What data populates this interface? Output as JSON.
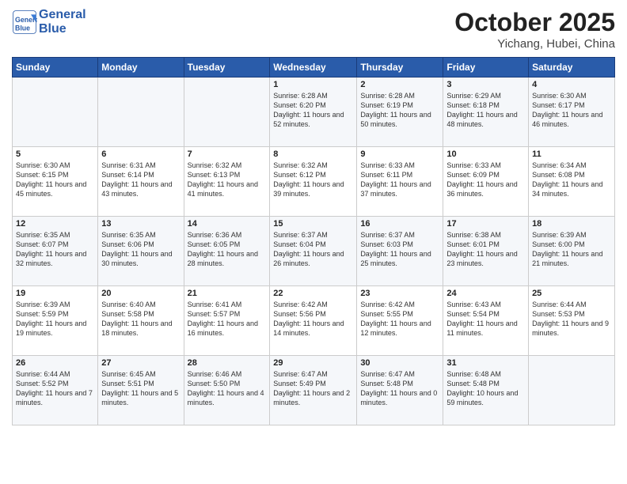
{
  "header": {
    "logo_line1": "General",
    "logo_line2": "Blue",
    "month": "October 2025",
    "location": "Yichang, Hubei, China"
  },
  "weekdays": [
    "Sunday",
    "Monday",
    "Tuesday",
    "Wednesday",
    "Thursday",
    "Friday",
    "Saturday"
  ],
  "weeks": [
    [
      {
        "day": "",
        "sunrise": "",
        "sunset": "",
        "daylight": ""
      },
      {
        "day": "",
        "sunrise": "",
        "sunset": "",
        "daylight": ""
      },
      {
        "day": "",
        "sunrise": "",
        "sunset": "",
        "daylight": ""
      },
      {
        "day": "1",
        "sunrise": "Sunrise: 6:28 AM",
        "sunset": "Sunset: 6:20 PM",
        "daylight": "Daylight: 11 hours and 52 minutes."
      },
      {
        "day": "2",
        "sunrise": "Sunrise: 6:28 AM",
        "sunset": "Sunset: 6:19 PM",
        "daylight": "Daylight: 11 hours and 50 minutes."
      },
      {
        "day": "3",
        "sunrise": "Sunrise: 6:29 AM",
        "sunset": "Sunset: 6:18 PM",
        "daylight": "Daylight: 11 hours and 48 minutes."
      },
      {
        "day": "4",
        "sunrise": "Sunrise: 6:30 AM",
        "sunset": "Sunset: 6:17 PM",
        "daylight": "Daylight: 11 hours and 46 minutes."
      }
    ],
    [
      {
        "day": "5",
        "sunrise": "Sunrise: 6:30 AM",
        "sunset": "Sunset: 6:15 PM",
        "daylight": "Daylight: 11 hours and 45 minutes."
      },
      {
        "day": "6",
        "sunrise": "Sunrise: 6:31 AM",
        "sunset": "Sunset: 6:14 PM",
        "daylight": "Daylight: 11 hours and 43 minutes."
      },
      {
        "day": "7",
        "sunrise": "Sunrise: 6:32 AM",
        "sunset": "Sunset: 6:13 PM",
        "daylight": "Daylight: 11 hours and 41 minutes."
      },
      {
        "day": "8",
        "sunrise": "Sunrise: 6:32 AM",
        "sunset": "Sunset: 6:12 PM",
        "daylight": "Daylight: 11 hours and 39 minutes."
      },
      {
        "day": "9",
        "sunrise": "Sunrise: 6:33 AM",
        "sunset": "Sunset: 6:11 PM",
        "daylight": "Daylight: 11 hours and 37 minutes."
      },
      {
        "day": "10",
        "sunrise": "Sunrise: 6:33 AM",
        "sunset": "Sunset: 6:09 PM",
        "daylight": "Daylight: 11 hours and 36 minutes."
      },
      {
        "day": "11",
        "sunrise": "Sunrise: 6:34 AM",
        "sunset": "Sunset: 6:08 PM",
        "daylight": "Daylight: 11 hours and 34 minutes."
      }
    ],
    [
      {
        "day": "12",
        "sunrise": "Sunrise: 6:35 AM",
        "sunset": "Sunset: 6:07 PM",
        "daylight": "Daylight: 11 hours and 32 minutes."
      },
      {
        "day": "13",
        "sunrise": "Sunrise: 6:35 AM",
        "sunset": "Sunset: 6:06 PM",
        "daylight": "Daylight: 11 hours and 30 minutes."
      },
      {
        "day": "14",
        "sunrise": "Sunrise: 6:36 AM",
        "sunset": "Sunset: 6:05 PM",
        "daylight": "Daylight: 11 hours and 28 minutes."
      },
      {
        "day": "15",
        "sunrise": "Sunrise: 6:37 AM",
        "sunset": "Sunset: 6:04 PM",
        "daylight": "Daylight: 11 hours and 26 minutes."
      },
      {
        "day": "16",
        "sunrise": "Sunrise: 6:37 AM",
        "sunset": "Sunset: 6:03 PM",
        "daylight": "Daylight: 11 hours and 25 minutes."
      },
      {
        "day": "17",
        "sunrise": "Sunrise: 6:38 AM",
        "sunset": "Sunset: 6:01 PM",
        "daylight": "Daylight: 11 hours and 23 minutes."
      },
      {
        "day": "18",
        "sunrise": "Sunrise: 6:39 AM",
        "sunset": "Sunset: 6:00 PM",
        "daylight": "Daylight: 11 hours and 21 minutes."
      }
    ],
    [
      {
        "day": "19",
        "sunrise": "Sunrise: 6:39 AM",
        "sunset": "Sunset: 5:59 PM",
        "daylight": "Daylight: 11 hours and 19 minutes."
      },
      {
        "day": "20",
        "sunrise": "Sunrise: 6:40 AM",
        "sunset": "Sunset: 5:58 PM",
        "daylight": "Daylight: 11 hours and 18 minutes."
      },
      {
        "day": "21",
        "sunrise": "Sunrise: 6:41 AM",
        "sunset": "Sunset: 5:57 PM",
        "daylight": "Daylight: 11 hours and 16 minutes."
      },
      {
        "day": "22",
        "sunrise": "Sunrise: 6:42 AM",
        "sunset": "Sunset: 5:56 PM",
        "daylight": "Daylight: 11 hours and 14 minutes."
      },
      {
        "day": "23",
        "sunrise": "Sunrise: 6:42 AM",
        "sunset": "Sunset: 5:55 PM",
        "daylight": "Daylight: 11 hours and 12 minutes."
      },
      {
        "day": "24",
        "sunrise": "Sunrise: 6:43 AM",
        "sunset": "Sunset: 5:54 PM",
        "daylight": "Daylight: 11 hours and 11 minutes."
      },
      {
        "day": "25",
        "sunrise": "Sunrise: 6:44 AM",
        "sunset": "Sunset: 5:53 PM",
        "daylight": "Daylight: 11 hours and 9 minutes."
      }
    ],
    [
      {
        "day": "26",
        "sunrise": "Sunrise: 6:44 AM",
        "sunset": "Sunset: 5:52 PM",
        "daylight": "Daylight: 11 hours and 7 minutes."
      },
      {
        "day": "27",
        "sunrise": "Sunrise: 6:45 AM",
        "sunset": "Sunset: 5:51 PM",
        "daylight": "Daylight: 11 hours and 5 minutes."
      },
      {
        "day": "28",
        "sunrise": "Sunrise: 6:46 AM",
        "sunset": "Sunset: 5:50 PM",
        "daylight": "Daylight: 11 hours and 4 minutes."
      },
      {
        "day": "29",
        "sunrise": "Sunrise: 6:47 AM",
        "sunset": "Sunset: 5:49 PM",
        "daylight": "Daylight: 11 hours and 2 minutes."
      },
      {
        "day": "30",
        "sunrise": "Sunrise: 6:47 AM",
        "sunset": "Sunset: 5:48 PM",
        "daylight": "Daylight: 11 hours and 0 minutes."
      },
      {
        "day": "31",
        "sunrise": "Sunrise: 6:48 AM",
        "sunset": "Sunset: 5:48 PM",
        "daylight": "Daylight: 10 hours and 59 minutes."
      },
      {
        "day": "",
        "sunrise": "",
        "sunset": "",
        "daylight": ""
      }
    ]
  ]
}
